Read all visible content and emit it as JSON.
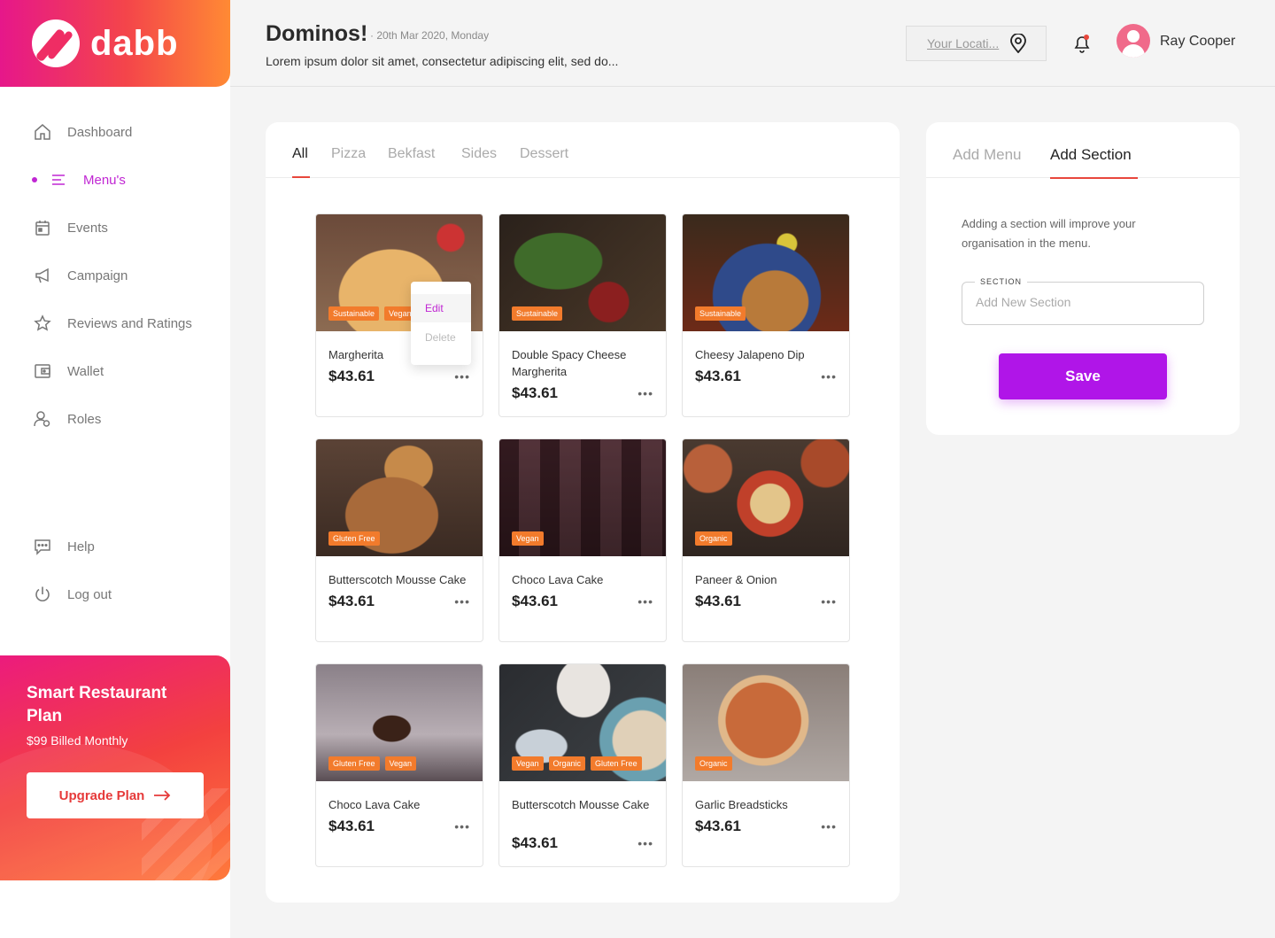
{
  "brand": {
    "name": "dabb"
  },
  "nav": {
    "items": [
      {
        "label": "Dashboard",
        "icon": "home-icon"
      },
      {
        "label": "Menu's",
        "icon": "menu-icon"
      },
      {
        "label": "Events",
        "icon": "calendar-icon"
      },
      {
        "label": "Campaign",
        "icon": "megaphone-icon"
      },
      {
        "label": "Reviews and Ratings",
        "icon": "star-icon"
      },
      {
        "label": "Wallet",
        "icon": "wallet-icon"
      },
      {
        "label": "Roles",
        "icon": "roles-icon"
      }
    ],
    "bottom": [
      {
        "label": "Help",
        "icon": "chat-icon"
      },
      {
        "label": "Log out",
        "icon": "power-icon"
      }
    ]
  },
  "promo": {
    "title": "Smart Restaurant Plan",
    "subtitle": "$99 Billed Monthly",
    "button": "Upgrade Plan"
  },
  "header": {
    "title": "Dominos!",
    "date": "· 20th Mar 2020, Monday",
    "subtitle": "Lorem ipsum dolor sit amet, consectetur adipiscing elit, sed do...",
    "location_placeholder": "Your Locati...",
    "user_name": "Ray Cooper"
  },
  "menu_tabs": [
    "All",
    "Pizza",
    "Bekfast",
    "Sides",
    "Dessert"
  ],
  "items": [
    {
      "name": "Margherita",
      "price": "$43.61",
      "tags": [
        "Sustainable",
        "Vegan"
      ]
    },
    {
      "name": "Double Spacy Cheese Margherita",
      "price": "$43.61",
      "tags": [
        "Sustainable"
      ]
    },
    {
      "name": "Cheesy Jalapeno Dip",
      "price": "$43.61",
      "tags": [
        "Sustainable"
      ]
    },
    {
      "name": "Butterscotch Mousse Cake",
      "price": "$43.61",
      "tags": [
        "Gluten Free"
      ]
    },
    {
      "name": "Choco Lava Cake",
      "price": "$43.61",
      "tags": [
        "Vegan"
      ]
    },
    {
      "name": "Paneer & Onion",
      "price": "$43.61",
      "tags": [
        "Organic"
      ]
    },
    {
      "name": "Choco Lava Cake",
      "price": "$43.61",
      "tags": [
        "Gluten Free",
        "Vegan"
      ]
    },
    {
      "name": "Butterscotch Mousse Cake",
      "price": "$43.61",
      "tags": [
        "Vegan",
        "Organic",
        "Gluten Free"
      ]
    },
    {
      "name": "Garlic Breadsticks",
      "price": "$43.61",
      "tags": [
        "Organic"
      ]
    }
  ],
  "context_menu": {
    "edit": "Edit",
    "delete": "Delete"
  },
  "panel": {
    "tabs": [
      "Add Menu",
      "Add Section"
    ],
    "description": "Adding a section will improve your organisation in the menu.",
    "field_label": "SECTION",
    "field_placeholder": "Add New Section",
    "save": "Save"
  },
  "colors": {
    "accent": "#c026d3",
    "save": "#b015e8",
    "tag": "#f27b2c",
    "underline": "#e8473c"
  }
}
